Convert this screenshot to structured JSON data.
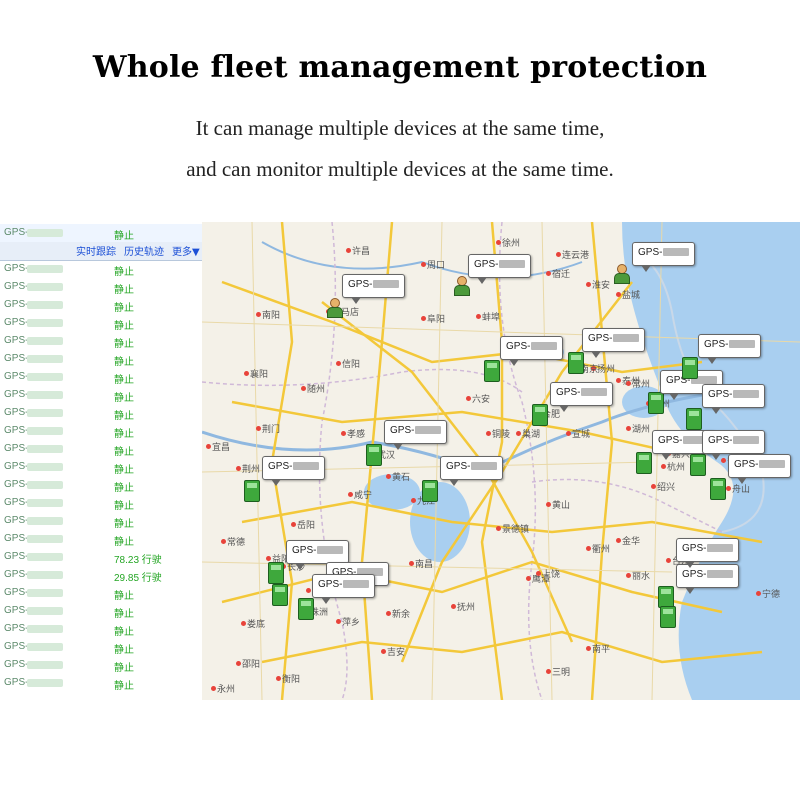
{
  "headline": "Whole fleet management protection",
  "subline1": "It can manage multiple devices at the same time,",
  "subline2": "and can monitor multiple devices at the same time.",
  "panel": {
    "toolbar": {
      "realtime": "实时跟踪",
      "history": "历史轨迹",
      "more": "更多▼"
    },
    "rows": [
      {
        "id": "GPS-",
        "status": "静止"
      },
      {
        "id": "GPS-",
        "status": "静止"
      },
      {
        "id": "GPS-",
        "status": "静止"
      },
      {
        "id": "GPS-",
        "status": "静止"
      },
      {
        "id": "GPS-",
        "status": "静止"
      },
      {
        "id": "GPS-",
        "status": "静止"
      },
      {
        "id": "GPS-",
        "status": "静止"
      },
      {
        "id": "GPS-",
        "status": "静止"
      },
      {
        "id": "GPS-",
        "status": "静止"
      },
      {
        "id": "GPS-",
        "status": "静止"
      },
      {
        "id": "GPS-",
        "status": "静止"
      },
      {
        "id": "GPS-",
        "status": "静止"
      },
      {
        "id": "GPS-",
        "status": "静止"
      },
      {
        "id": "GPS-",
        "status": "静止"
      },
      {
        "id": "GPS-",
        "status": "静止"
      },
      {
        "id": "GPS-",
        "status": "静止"
      },
      {
        "id": "GPS-",
        "status": "静止"
      },
      {
        "id": "GPS-",
        "status": "78.23 行驶"
      },
      {
        "id": "GPS-",
        "status": "29.85 行驶"
      },
      {
        "id": "GPS-",
        "status": "静止"
      },
      {
        "id": "GPS-",
        "status": "静止"
      },
      {
        "id": "GPS-",
        "status": "静止"
      },
      {
        "id": "GPS-",
        "status": "静止"
      },
      {
        "id": "GPS-",
        "status": "静止"
      },
      {
        "id": "GPS-",
        "status": "静止"
      }
    ]
  },
  "map": {
    "cities": [
      "许昌",
      "徐州",
      "周口",
      "连云港",
      "宿迁",
      "驻马店",
      "淮安",
      "盐城",
      "南阳",
      "阜阳",
      "蚌埠",
      "信阳",
      "襄阳",
      "随州",
      "扬州",
      "泰州",
      "南京",
      "常州",
      "荆门",
      "六安",
      "合肥",
      "宜昌",
      "孝感",
      "武汉",
      "巢湖",
      "铜陵",
      "宣城",
      "湖州",
      "荆州",
      "黄石",
      "咸宁",
      "九江",
      "黄山",
      "嘉兴",
      "绍兴",
      "舟山",
      "岳阳",
      "景德镇",
      "衢州",
      "金华",
      "常德",
      "益阳",
      "长沙",
      "南昌",
      "鹰潭",
      "上饶",
      "丽水",
      "湘潭",
      "萍乡",
      "新余",
      "抚州",
      "娄底",
      "株洲",
      "吉安",
      "宁德",
      "邵阳",
      "衡阳",
      "永州",
      "三明",
      "南平",
      "台州",
      "杭州",
      "宁波",
      "上海",
      "苏州"
    ],
    "vehicle_label_prefix": "GPS-"
  }
}
